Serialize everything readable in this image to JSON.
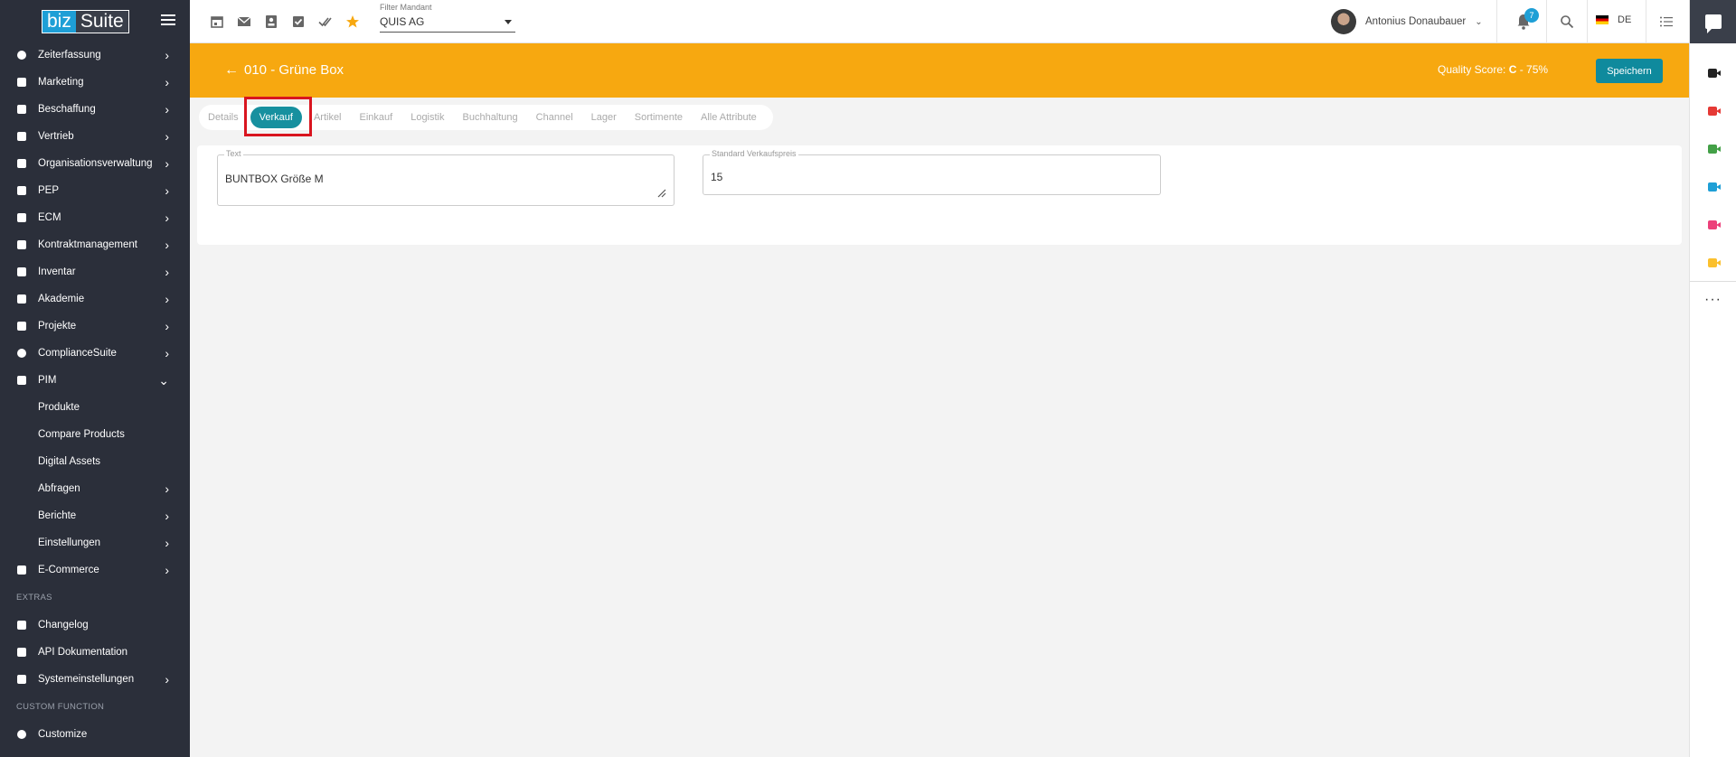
{
  "brand": {
    "part1": "biz",
    "part2": "Suite"
  },
  "sidebar": {
    "items": [
      {
        "label": "Zeiterfassung",
        "icon": "clock-icon",
        "chevron": "›"
      },
      {
        "label": "Marketing",
        "icon": "megaphone-icon",
        "chevron": "›"
      },
      {
        "label": "Beschaffung",
        "icon": "truck-icon",
        "chevron": "›"
      },
      {
        "label": "Vertrieb",
        "icon": "people-icon",
        "chevron": "›"
      },
      {
        "label": "Organisationsverwaltung",
        "icon": "org-icon",
        "chevron": "›"
      },
      {
        "label": "PEP",
        "icon": "group-icon",
        "chevron": "›"
      },
      {
        "label": "ECM",
        "icon": "folder-icon",
        "chevron": "›"
      },
      {
        "label": "Kontraktmanagement",
        "icon": "briefcase-icon",
        "chevron": "›"
      },
      {
        "label": "Inventar",
        "icon": "lock-icon",
        "chevron": "›"
      },
      {
        "label": "Akademie",
        "icon": "graduation-cap-icon",
        "chevron": "›"
      },
      {
        "label": "Projekte",
        "icon": "project-icon",
        "chevron": "›"
      },
      {
        "label": "ComplianceSuite",
        "icon": "shield-icon",
        "chevron": "›"
      },
      {
        "label": "PIM",
        "icon": "pim-icon",
        "chevron": "⌄"
      }
    ],
    "pim_subitems": [
      {
        "label": "Produkte",
        "chevron": ""
      },
      {
        "label": "Compare Products",
        "chevron": ""
      },
      {
        "label": "Digital Assets",
        "chevron": ""
      },
      {
        "label": "Abfragen",
        "chevron": "›"
      },
      {
        "label": "Berichte",
        "chevron": "›"
      },
      {
        "label": "Einstellungen",
        "chevron": "›"
      }
    ],
    "ecommerce": {
      "label": "E-Commerce",
      "icon": "cart-icon",
      "chevron": "›"
    },
    "extras_heading": "EXTRAS",
    "extras": [
      {
        "label": "Changelog",
        "icon": "document-icon",
        "chevron": ""
      },
      {
        "label": "API Dokumentation",
        "icon": "document-icon",
        "chevron": ""
      },
      {
        "label": "Systemeinstellungen",
        "icon": "lock-icon",
        "chevron": "›"
      }
    ],
    "custom_heading": "CUSTOM FUNCTION",
    "custom": [
      {
        "label": "Customize",
        "icon": "gear-icon",
        "chevron": ""
      }
    ]
  },
  "topbar": {
    "filter_label": "Filter Mandant",
    "filter_value": "QUIS AG",
    "user_name": "Antonius Donaubauer",
    "notification_count": "7",
    "language": "DE"
  },
  "header": {
    "title": "010 - Grüne Box",
    "quality_prefix": "Quality Score: ",
    "quality_grade": "C",
    "quality_suffix": " -  75%",
    "save_label": "Speichern"
  },
  "tabs": [
    {
      "label": "Details",
      "active": false
    },
    {
      "label": "Verkauf",
      "active": true
    },
    {
      "label": "Artikel",
      "active": false
    },
    {
      "label": "Einkauf",
      "active": false
    },
    {
      "label": "Logistik",
      "active": false
    },
    {
      "label": "Buchhaltung",
      "active": false
    },
    {
      "label": "Channel",
      "active": false
    },
    {
      "label": "Lager",
      "active": false
    },
    {
      "label": "Sortimente",
      "active": false
    },
    {
      "label": "Alle Attribute",
      "active": false
    }
  ],
  "form": {
    "text_label": "Text",
    "text_value": "BUNTBOX Größe M",
    "price_label": "Standard Verkaufspreis",
    "price_value": "15"
  },
  "rail": {
    "camera_colors": [
      "#222222",
      "#e53935",
      "#43a047",
      "#1e9fd6",
      "#ec407a",
      "#fbc02d"
    ]
  }
}
